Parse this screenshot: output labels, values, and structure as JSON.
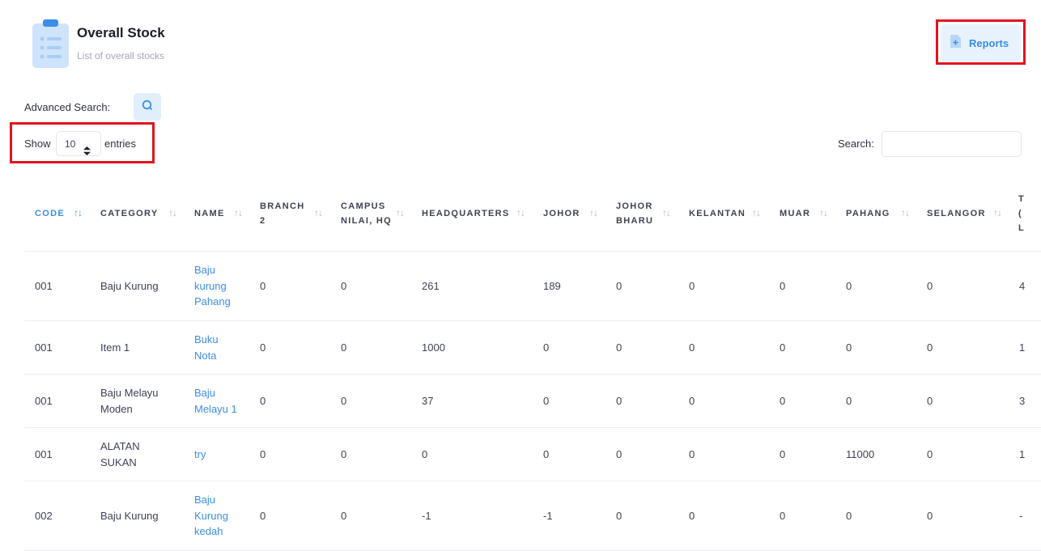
{
  "header": {
    "title": "Overall Stock",
    "subtitle": "List of overall stocks",
    "reports_label": "Reports"
  },
  "colors": {
    "accent": "#3a8ee6",
    "highlight": "#e0141e",
    "light_accent": "#e8f2fd"
  },
  "advanced_search": {
    "label": "Advanced Search:",
    "icon": "search-icon"
  },
  "length": {
    "show_label": "Show",
    "selected": "10",
    "entries_label": "entries"
  },
  "search": {
    "label": "Search:",
    "value": ""
  },
  "table": {
    "columns": [
      "CODE",
      "CATEGORY",
      "NAME",
      "BRANCH 2",
      "CAMPUS NILAI, HQ",
      "HEADQUARTERS",
      "JOHOR",
      "JOHOR BHARU",
      "KELANTAN",
      "MUAR",
      "PAHANG",
      "SELANGOR",
      "T ( L"
    ],
    "rows": [
      {
        "code": "001",
        "category": "Baju Kurung",
        "name": "Baju kurung Pahang",
        "values": [
          "0",
          "0",
          "261",
          "189",
          "0",
          "0",
          "0",
          "0",
          "0",
          "4"
        ]
      },
      {
        "code": "001",
        "category": "Item 1",
        "name": "Buku Nota",
        "values": [
          "0",
          "0",
          "1000",
          "0",
          "0",
          "0",
          "0",
          "0",
          "0",
          "1"
        ]
      },
      {
        "code": "001",
        "category": "Baju Melayu Moden",
        "name": "Baju Melayu 1",
        "values": [
          "0",
          "0",
          "37",
          "0",
          "0",
          "0",
          "0",
          "0",
          "0",
          "3"
        ]
      },
      {
        "code": "001",
        "category": "ALATAN SUKAN",
        "name": "try",
        "values": [
          "0",
          "0",
          "0",
          "0",
          "0",
          "0",
          "0",
          "11000",
          "0",
          "1"
        ]
      },
      {
        "code": "002",
        "category": "Baju Kurung",
        "name": "Baju Kurung kedah",
        "values": [
          "0",
          "0",
          "-1",
          "-1",
          "0",
          "0",
          "0",
          "0",
          "0",
          "-"
        ]
      }
    ]
  }
}
